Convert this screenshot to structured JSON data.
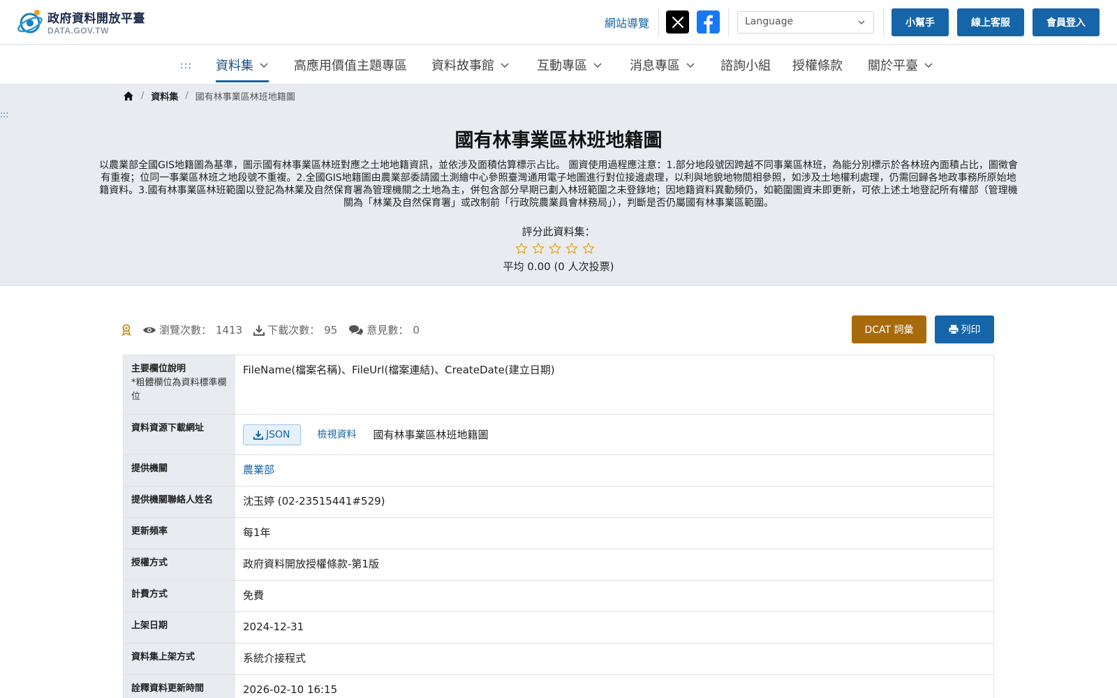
{
  "header": {
    "logo_zh": "政府資料開放平臺",
    "logo_en": "DATA.GOV.TW",
    "sitemap": "網站導覽",
    "language_placeholder": "Language",
    "buttons": {
      "helper": "小幫手",
      "service": "線上客服",
      "login": "會員登入"
    }
  },
  "nav": {
    "accesskey": ":::",
    "items": [
      {
        "label": "資料集"
      },
      {
        "label": "高應用價值主題專區"
      },
      {
        "label": "資料故事館"
      },
      {
        "label": "互動專區"
      },
      {
        "label": "消息專區"
      },
      {
        "label": "諮詢小組"
      },
      {
        "label": "授權條款"
      },
      {
        "label": "關於平臺"
      }
    ]
  },
  "breadcrumb": {
    "sep": "/",
    "level1": "資料集",
    "current": "國有林事業區林班地籍圖"
  },
  "side_accesskey": ":::",
  "dataset": {
    "title": "國有林事業區林班地籍圖",
    "description": "以農業部全國GIS地籍圖為基準，圖示國有林事業區林班對應之土地地籍資訊，並依涉及面積估算標示占比。 圖資使用過程應注意：1.部分地段號因跨越不同事業區林班，為能分別標示於各林班內面積占比，圖徵會有重複；位同一事業區林班之地段號不重複。2.全國GIS地籍圖由農業部委請國土測繪中心參照臺灣通用電子地圖進行對位接邊處理，以利與地貌地物間相參照，如涉及土地權利處理，仍需回歸各地政事務所原始地籍資料。3.國有林事業區林班範圍以登記為林業及自然保育署為管理機關之土地為主，併包含部分早期已劃入林班範圍之未登錄地；因地籍資料異動頻仍，如範圍圖資未即更新，可依上述土地登記所有權部（管理機關為「林業及自然保育署」或改制前「行政院農業員會林務局」），判斷是否仍屬國有林事業區範圍。",
    "rate_label": "評分此資料集：",
    "rating": 0,
    "rating_max": 5,
    "average_text": "平均 0.00 (0 人次投票)"
  },
  "stats": {
    "views_label": "瀏覽次數：",
    "views": "1413",
    "downloads_label": "下載次數：",
    "downloads": "95",
    "comments_label": "意見數：",
    "comments": "0",
    "dcat_button": "DCAT 詞彙",
    "print_button": "列印"
  },
  "table": {
    "main_fields_label": "主要欄位說明",
    "main_fields_note": "*粗體欄位為資料標準欄位",
    "main_fields_value": "FileName(檔案名稱)、FileUrl(檔案連結)、CreateDate(建立日期)",
    "download_label": "資料資源下載網址",
    "download_format": "JSON",
    "view_data": "檢視資料",
    "resource_name": "國有林事業區林班地籍圖",
    "provider_label": "提供機關",
    "provider": "農業部",
    "contact_label": "提供機關聯絡人姓名",
    "contact": "沈玉婷 (02-23515441#529)",
    "frequency_label": "更新頻率",
    "frequency": "每1年",
    "license_label": "授權方式",
    "license": "政府資料開放授權條款-第1版",
    "fee_label": "計費方式",
    "fee": "免費",
    "publish_date_label": "上架日期",
    "publish_date": "2024-12-31",
    "publish_method_label": "資料集上架方式",
    "publish_method": "系統介接程式",
    "metadata_updated_label": "詮釋資料更新時間",
    "metadata_updated": "2026-02-10 16:15"
  },
  "colors": {
    "primary": "#1565a8",
    "dcat": "#a86b0c",
    "hero_bg": "#e8ecf1",
    "star": "#e5a417"
  }
}
